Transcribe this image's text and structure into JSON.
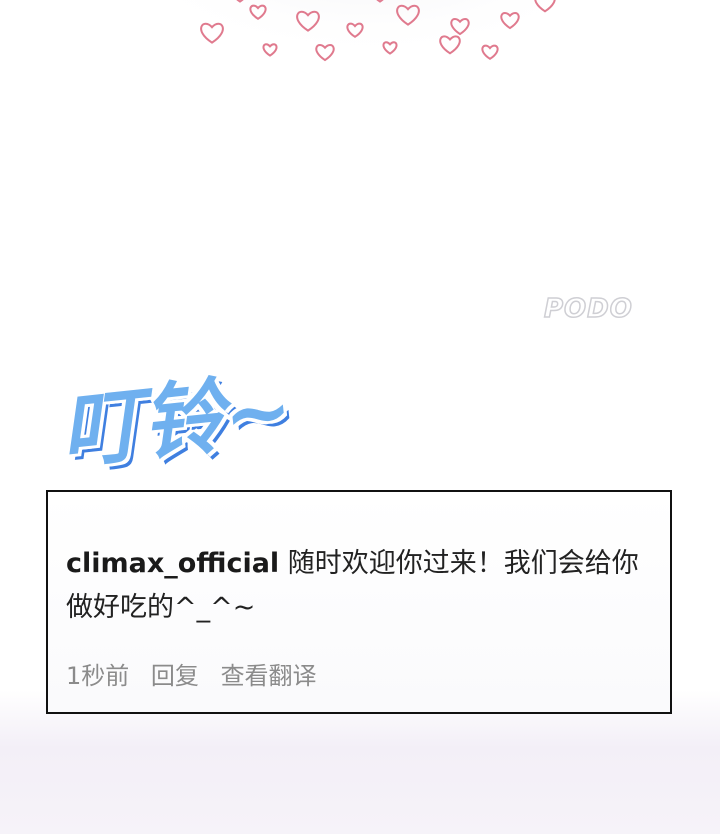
{
  "sfx_text": "叮铃~",
  "watermark": "PODO",
  "comment": {
    "username": "climax_official",
    "text": "随时欢迎你过来！我们会给你做好吃的^_^~",
    "time": "1秒前",
    "reply_label": "回复",
    "translate_label": "查看翻译"
  },
  "colors": {
    "sfx_fill": "#6fb0ef",
    "sfx_shadow": "#3f7fe0",
    "heart_stroke": "#e07a8e",
    "meta_text": "#8b8b8b"
  }
}
